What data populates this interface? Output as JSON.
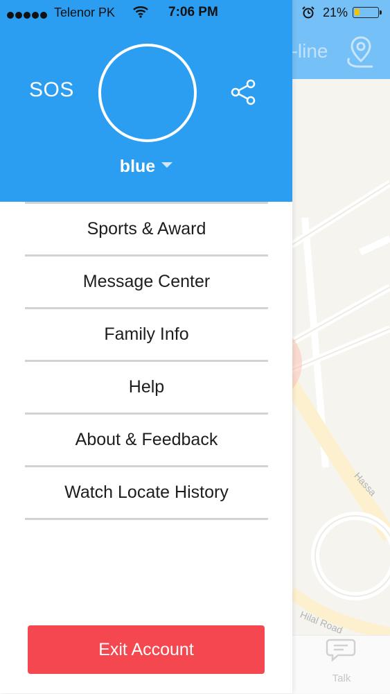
{
  "status_bar": {
    "carrier": "Telenor PK",
    "time": "7:06 PM",
    "battery_percent": "21%",
    "battery_level": 0.21,
    "icons": [
      "signal-dots-icon",
      "wifi-icon",
      "alarm-clock-icon",
      "battery-icon"
    ]
  },
  "background_screen": {
    "title_fragment": "n-line",
    "icons": [
      "location-pin-icon",
      "talk-bubble-icon"
    ],
    "bottom_tab_label": "Talk",
    "map_labels": [
      "Hassa",
      "Hilal Road"
    ]
  },
  "drawer": {
    "sos_label": "SOS",
    "share_icon": "share-icon",
    "device_name": "blue",
    "menu_items": [
      {
        "label": "Sports & Award"
      },
      {
        "label": "Message Center"
      },
      {
        "label": "Family Info"
      },
      {
        "label": "Help"
      },
      {
        "label": "About & Feedback"
      },
      {
        "label": "Watch Locate History"
      }
    ],
    "exit_label": "Exit Account"
  },
  "colors": {
    "header_blue": "#2c9ef2",
    "exit_red": "#f5474f",
    "divider_gray": "#d2d2d2"
  }
}
